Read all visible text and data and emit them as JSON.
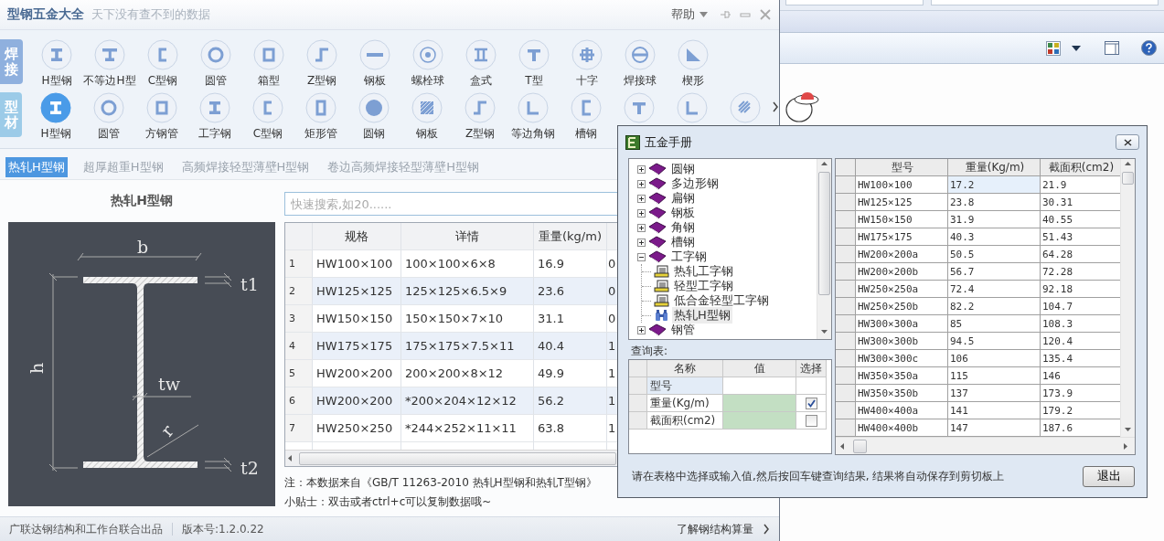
{
  "app": {
    "title": "型钢五金大全",
    "subtitle": "天下没有查不到的数据",
    "help": "帮助"
  },
  "icon_rows": [
    {
      "category": "焊接",
      "items": [
        {
          "label": "H型钢",
          "selected": false
        },
        {
          "label": "不等边H型",
          "selected": false
        },
        {
          "label": "C型钢",
          "selected": false
        },
        {
          "label": "圆管",
          "selected": false
        },
        {
          "label": "箱型",
          "selected": false
        },
        {
          "label": "Z型钢",
          "selected": false
        },
        {
          "label": "钢板",
          "selected": false
        },
        {
          "label": "螺栓球",
          "selected": false
        },
        {
          "label": "盒式",
          "selected": false
        },
        {
          "label": "T型",
          "selected": false
        },
        {
          "label": "十字",
          "selected": false
        },
        {
          "label": "焊接球",
          "selected": false
        },
        {
          "label": "楔形",
          "selected": false
        }
      ]
    },
    {
      "category": "型材",
      "items": [
        {
          "label": "H型钢",
          "selected": true
        },
        {
          "label": "圆管",
          "selected": false
        },
        {
          "label": "方钢管",
          "selected": false
        },
        {
          "label": "工字钢",
          "selected": false
        },
        {
          "label": "C型钢",
          "selected": false
        },
        {
          "label": "矩形管",
          "selected": false
        },
        {
          "label": "圆钢",
          "selected": false
        },
        {
          "label": "钢板",
          "selected": false
        },
        {
          "label": "Z型钢",
          "selected": false
        },
        {
          "label": "等边角钢",
          "selected": false
        },
        {
          "label": "槽钢",
          "selected": false
        },
        {
          "selected": false
        },
        {
          "selected": false
        },
        {
          "selected": false
        }
      ]
    }
  ],
  "sub_tabs": [
    {
      "label": "热轧H型钢",
      "selected": true
    },
    {
      "label": "超厚超重H型钢",
      "selected": false
    },
    {
      "label": "高频焊接轻型薄壁H型钢",
      "selected": false
    },
    {
      "label": "卷边高频焊接轻型薄壁H型钢",
      "selected": false
    }
  ],
  "panel_title": "热轧H型钢",
  "diagram_labels": [
    "b",
    "t1",
    "h",
    "tw",
    "r",
    "t2"
  ],
  "search": {
    "placeholder": "快速搜索,如20......"
  },
  "table": {
    "columns": [
      "规格",
      "详情",
      "重量(kg/m)"
    ],
    "rows": [
      {
        "index": "1",
        "cells": [
          "HW100×100",
          "100×100×6×8",
          "16.9",
          "0"
        ]
      },
      {
        "index": "2",
        "cells": [
          "HW125×125",
          "125×125×6.5×9",
          "23.6",
          "0"
        ]
      },
      {
        "index": "3",
        "cells": [
          "HW150×150",
          "150×150×7×10",
          "31.1",
          "0"
        ]
      },
      {
        "index": "4",
        "cells": [
          "HW175×175",
          "175×175×7.5×11",
          "40.4",
          "1"
        ]
      },
      {
        "index": "5",
        "cells": [
          "HW200×200",
          "200×200×8×12",
          "49.9",
          "1"
        ]
      },
      {
        "index": "6",
        "cells": [
          "HW200×200",
          "*200×204×12×12",
          "56.2",
          "1"
        ]
      },
      {
        "index": "7",
        "cells": [
          "HW250×250",
          "*244×252×11×11",
          "63.8",
          "1"
        ]
      }
    ]
  },
  "notes": [
    "注：本数据来自《GB/T 11263-2010 热轧H型钢和热轧T型钢》",
    "小贴士：双击或者ctrl+c可以复制数据哦~"
  ],
  "status_bar": {
    "credit": "广联达钢结构和工作台联合出品",
    "version": "版本号:1.2.0.22",
    "link": "了解钢结构算量"
  },
  "dialog": {
    "title": "五金手册",
    "tree": [
      {
        "label": "圆钢",
        "expanded": false
      },
      {
        "label": "多边形钢",
        "expanded": false
      },
      {
        "label": "扁钢",
        "expanded": false
      },
      {
        "label": "钢板",
        "expanded": false
      },
      {
        "label": "角钢",
        "expanded": false
      },
      {
        "label": "槽钢",
        "expanded": false
      },
      {
        "label": "工字钢",
        "expanded": true,
        "children": [
          {
            "label": "热轧工字钢",
            "selected": false
          },
          {
            "label": "轻型工字钢",
            "selected": false
          },
          {
            "label": "低合金轻型工字钢",
            "selected": false
          },
          {
            "label": "热轧H型钢",
            "selected": true
          }
        ]
      },
      {
        "label": "钢管",
        "expanded": false
      }
    ],
    "query_label": "查询表:",
    "query_grid": {
      "columns": [
        "名称",
        "值",
        "选择"
      ],
      "rows": [
        {
          "kind": "text",
          "name": "型号",
          "selected": true
        },
        {
          "kind": "check",
          "name": "重量(Kg/m)",
          "checked": true,
          "selected": false
        },
        {
          "kind": "check",
          "name": "截面积(cm2)",
          "checked": false,
          "selected": false
        }
      ]
    },
    "table": {
      "columns": [
        "型号",
        "重量(Kg/m)",
        "截面积(cm2)"
      ],
      "rows": [
        {
          "cells": [
            "HW100×100",
            "17.2",
            "21.9"
          ],
          "selected": true
        },
        {
          "cells": [
            "HW125×125",
            "23.8",
            "30.31"
          ],
          "selected": false
        },
        {
          "cells": [
            "HW150×150",
            "31.9",
            "40.55"
          ],
          "selected": false
        },
        {
          "cells": [
            "HW175×175",
            "40.3",
            "51.43"
          ],
          "selected": false
        },
        {
          "cells": [
            "HW200×200a",
            "50.5",
            "64.28"
          ],
          "selected": false
        },
        {
          "cells": [
            "HW200×200b",
            "56.7",
            "72.28"
          ],
          "selected": false
        },
        {
          "cells": [
            "HW250×250a",
            "72.4",
            "92.18"
          ],
          "selected": false
        },
        {
          "cells": [
            "HW250×250b",
            "82.2",
            "104.7"
          ],
          "selected": false
        },
        {
          "cells": [
            "HW300×300a",
            "85",
            "108.3"
          ],
          "selected": false
        },
        {
          "cells": [
            "HW300×300b",
            "94.5",
            "120.4"
          ],
          "selected": false
        },
        {
          "cells": [
            "HW300×300c",
            "106",
            "135.4"
          ],
          "selected": false
        },
        {
          "cells": [
            "HW350×350a",
            "115",
            "146"
          ],
          "selected": false
        },
        {
          "cells": [
            "HW350×350b",
            "137",
            "173.9"
          ],
          "selected": false
        },
        {
          "cells": [
            "HW400×400a",
            "141",
            "179.2"
          ],
          "selected": false
        },
        {
          "cells": [
            "HW400×400b",
            "147",
            "187.6"
          ],
          "selected": false
        }
      ]
    },
    "footer": "请在表格中选择或输入值,然后按回车键查询结果, 结果将自动保存到剪切板上",
    "exit_button": "退出"
  }
}
